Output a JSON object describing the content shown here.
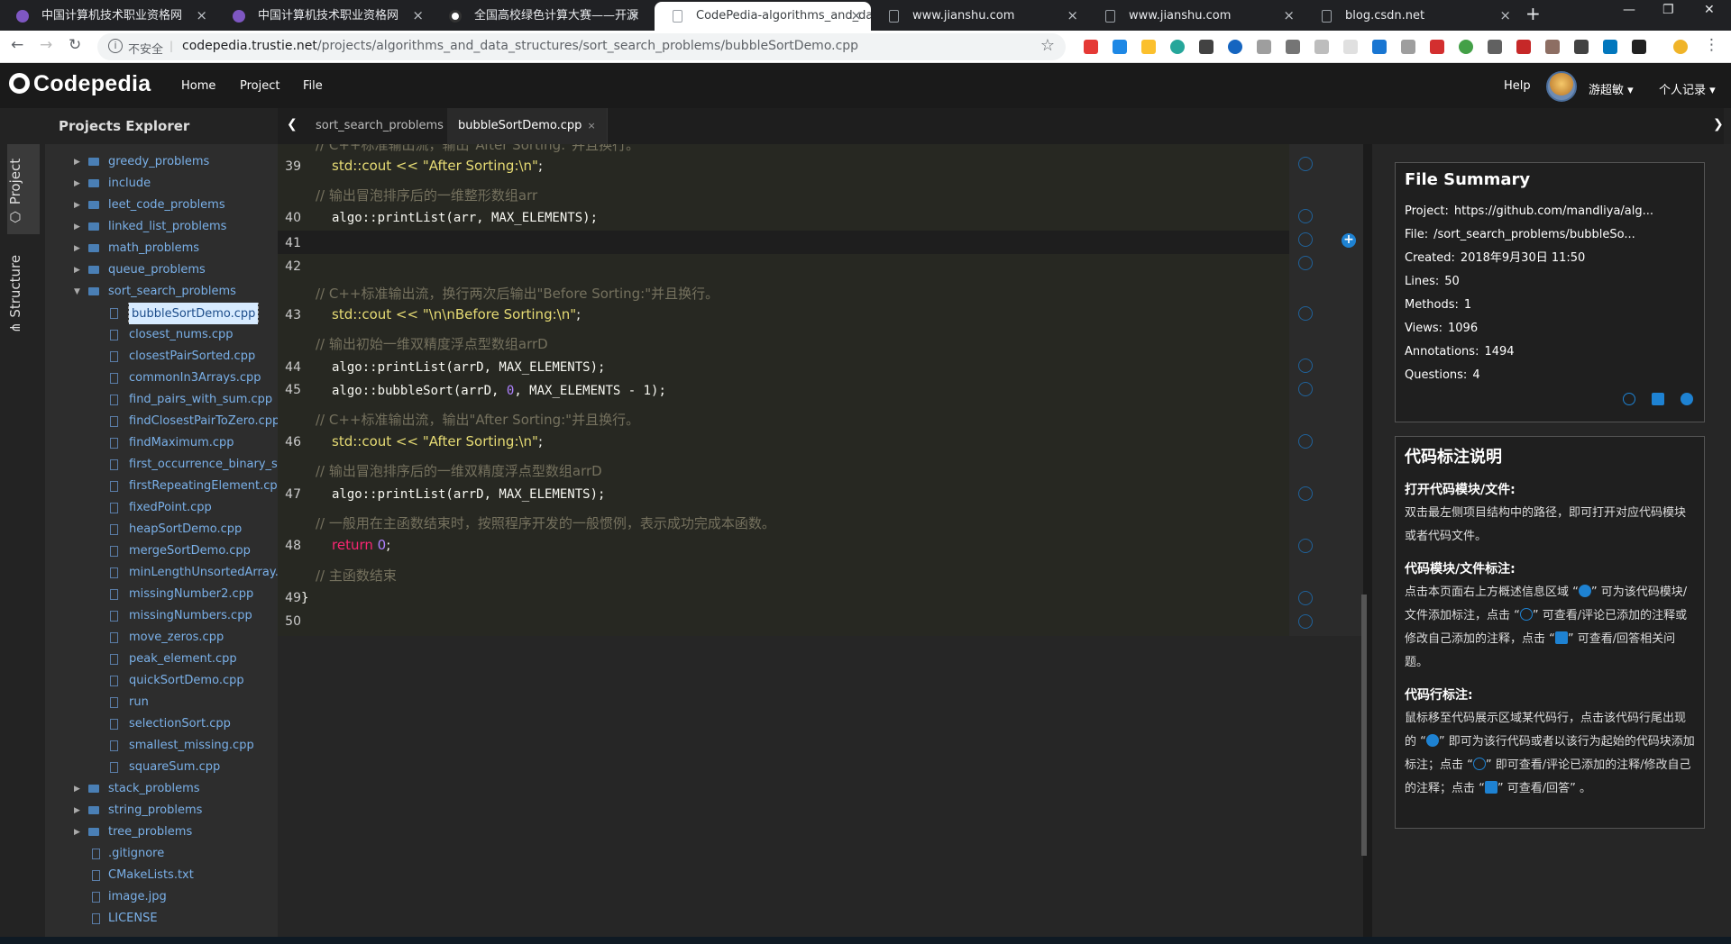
{
  "browser": {
    "tabs": [
      {
        "title": "中国计算机技术职业资格网",
        "close": "×"
      },
      {
        "title": "中国计算机技术职业资格网",
        "close": "×"
      },
      {
        "title": "全国高校绿色计算大赛——开源",
        "close": "×"
      },
      {
        "title": "CodePedia-algorithms_and_da",
        "close": "×"
      },
      {
        "title": "www.jianshu.com",
        "close": "×"
      },
      {
        "title": "www.jianshu.com",
        "close": "×"
      },
      {
        "title": "blog.csdn.net",
        "close": "×"
      }
    ],
    "insecure_label": "不安全",
    "url_host": "codepedia.trustie.net",
    "url_path": "/projects/algorithms_and_data_structures/sort_search_problems/bubbleSortDemo.cpp"
  },
  "app": {
    "logo": "Codepedia",
    "menu": [
      "Home",
      "Project",
      "File"
    ],
    "help": "Help",
    "username": "游超敏 ▾",
    "user_records": "个人记录 ▾"
  },
  "sidebar": {
    "tab_project": "Project",
    "tab_structure": "Structure",
    "title": "Projects Explorer",
    "tree": [
      {
        "label": "greedy_problems",
        "kind": "folder"
      },
      {
        "label": "include",
        "kind": "folder"
      },
      {
        "label": "leet_code_problems",
        "kind": "folder"
      },
      {
        "label": "linked_list_problems",
        "kind": "folder"
      },
      {
        "label": "math_problems",
        "kind": "folder"
      },
      {
        "label": "queue_problems",
        "kind": "folder"
      },
      {
        "label": "sort_search_problems",
        "kind": "folder-open"
      },
      {
        "label": "bubbleSortDemo.cpp",
        "kind": "child-selected"
      },
      {
        "label": "closest_nums.cpp",
        "kind": "child"
      },
      {
        "label": "closestPairSorted.cpp",
        "kind": "child"
      },
      {
        "label": "commonIn3Arrays.cpp",
        "kind": "child"
      },
      {
        "label": "find_pairs_with_sum.cpp",
        "kind": "child"
      },
      {
        "label": "findClosestPairToZero.cpp",
        "kind": "child"
      },
      {
        "label": "findMaximum.cpp",
        "kind": "child"
      },
      {
        "label": "first_occurrence_binary_search",
        "kind": "child"
      },
      {
        "label": "firstRepeatingElement.cpp",
        "kind": "child"
      },
      {
        "label": "fixedPoint.cpp",
        "kind": "child"
      },
      {
        "label": "heapSortDemo.cpp",
        "kind": "child"
      },
      {
        "label": "mergeSortDemo.cpp",
        "kind": "child"
      },
      {
        "label": "minLengthUnsortedArray.cpp",
        "kind": "child"
      },
      {
        "label": "missingNumber2.cpp",
        "kind": "child"
      },
      {
        "label": "missingNumbers.cpp",
        "kind": "child"
      },
      {
        "label": "move_zeros.cpp",
        "kind": "child"
      },
      {
        "label": "peak_element.cpp",
        "kind": "child"
      },
      {
        "label": "quickSortDemo.cpp",
        "kind": "child"
      },
      {
        "label": "run",
        "kind": "child"
      },
      {
        "label": "selectionSort.cpp",
        "kind": "child"
      },
      {
        "label": "smallest_missing.cpp",
        "kind": "child"
      },
      {
        "label": "squareSum.cpp",
        "kind": "child"
      },
      {
        "label": "stack_problems",
        "kind": "folder"
      },
      {
        "label": "string_problems",
        "kind": "folder"
      },
      {
        "label": "tree_problems",
        "kind": "folder"
      },
      {
        "label": ".gitignore",
        "kind": "rootfile"
      },
      {
        "label": "CMakeLists.txt",
        "kind": "rootfile"
      },
      {
        "label": "image.jpg",
        "kind": "rootfile"
      },
      {
        "label": "LICENSE",
        "kind": "rootfile"
      }
    ]
  },
  "editor": {
    "tabs": [
      {
        "label": "sort_search_problems",
        "close": "×"
      },
      {
        "label": "bubbleSortDemo.cpp",
        "close": "×"
      }
    ],
    "lines": {
      "l39": "39",
      "l40": "40",
      "l41": "41",
      "l42": "42",
      "l43": "43",
      "l44": "44",
      "l45": "45",
      "l46": "46",
      "l47": "47",
      "l48": "48",
      "l49": "49",
      "l50": "50"
    },
    "comments": {
      "c_top": "// C++标准输出流，输出\"After Sorting:\"并且换行。",
      "c40": "// 输出冒泡排序后的一维整形数组arr",
      "c43": "// C++标准输出流，换行两次后输出\"Before Sorting:\"并且换行。",
      "c44": "// 输出初始一维双精度浮点型数组arrD",
      "c46": "// C++标准输出流，输出\"After Sorting:\"并且换行。",
      "c47": "// 输出冒泡排序后的一维双精度浮点型数组arrD",
      "c48": "// 一般用在主函数结束时，按照程序开发的一般惯例，表示成功完成本函数。",
      "c49": "// 主函数结束"
    },
    "code": {
      "l39_a": "std::cout << ",
      "l39_s": "\"After Sorting:\\n\"",
      "l39_e": ";",
      "l40": "algo::printList(arr, MAX_ELEMENTS);",
      "l43_a": "std::cout << ",
      "l43_s": "\"\\n\\nBefore Sorting:\\n\"",
      "l43_e": ";",
      "l44": "algo::printList(arrD, MAX_ELEMENTS);",
      "l45_a": "algo::bubbleSort(arrD, ",
      "l45_n": "0",
      "l45_b": ", MAX_ELEMENTS - 1);",
      "l46_a": "std::cout << ",
      "l46_s": "\"After Sorting:\\n\"",
      "l46_e": ";",
      "l47": "algo::printList(arrD, MAX_ELEMENTS);",
      "l48_k": "return",
      "l48_n": " 0",
      "l48_e": ";",
      "l49": "}"
    }
  },
  "summary": {
    "title": "File Summary",
    "project_label": "Project:",
    "project": "https://github.com/mandliya/alg...",
    "file_label": "File:",
    "file": "/sort_search_problems/bubbleSo...",
    "created_label": "Created:",
    "created": "2018年9月30日 11:50",
    "lines_label": "Lines:",
    "lines": "50",
    "methods_label": "Methods:",
    "methods": "1",
    "views_label": "Views:",
    "views": "1096",
    "annotations_label": "Annotations:",
    "annotations": "1494",
    "questions_label": "Questions:",
    "questions": "4"
  },
  "help_card": {
    "title": "代码标注说明",
    "h1": "打开代码模块/文件:",
    "p1": "双击最左侧项目结构中的路径，即可打开对应代码模块或者代码文件。",
    "h2": "代码模块/文件标注:",
    "p2a": "点击本页面右上方概述信息区域 “",
    "p2b": "” 可为该代码模块/文件添加标注，点击 “",
    "p2c": "” 可查看/评论已添加的注释或修改自己添加的注释，点击 “",
    "p2d": "” 可查看/回答相关问题。",
    "h3": "代码行标注:",
    "p3a": "鼠标移至代码展示区域某代码行，点击该代码行尾出现的 “",
    "p3b": "” 即可为该行代码或者以该行为起始的代码块添加标注；点击 “",
    "p3c": "” 即可查看/评论已添加的注释/修改自己的注释；点击 “",
    "p3d": "” 可查看/回答” 。"
  }
}
